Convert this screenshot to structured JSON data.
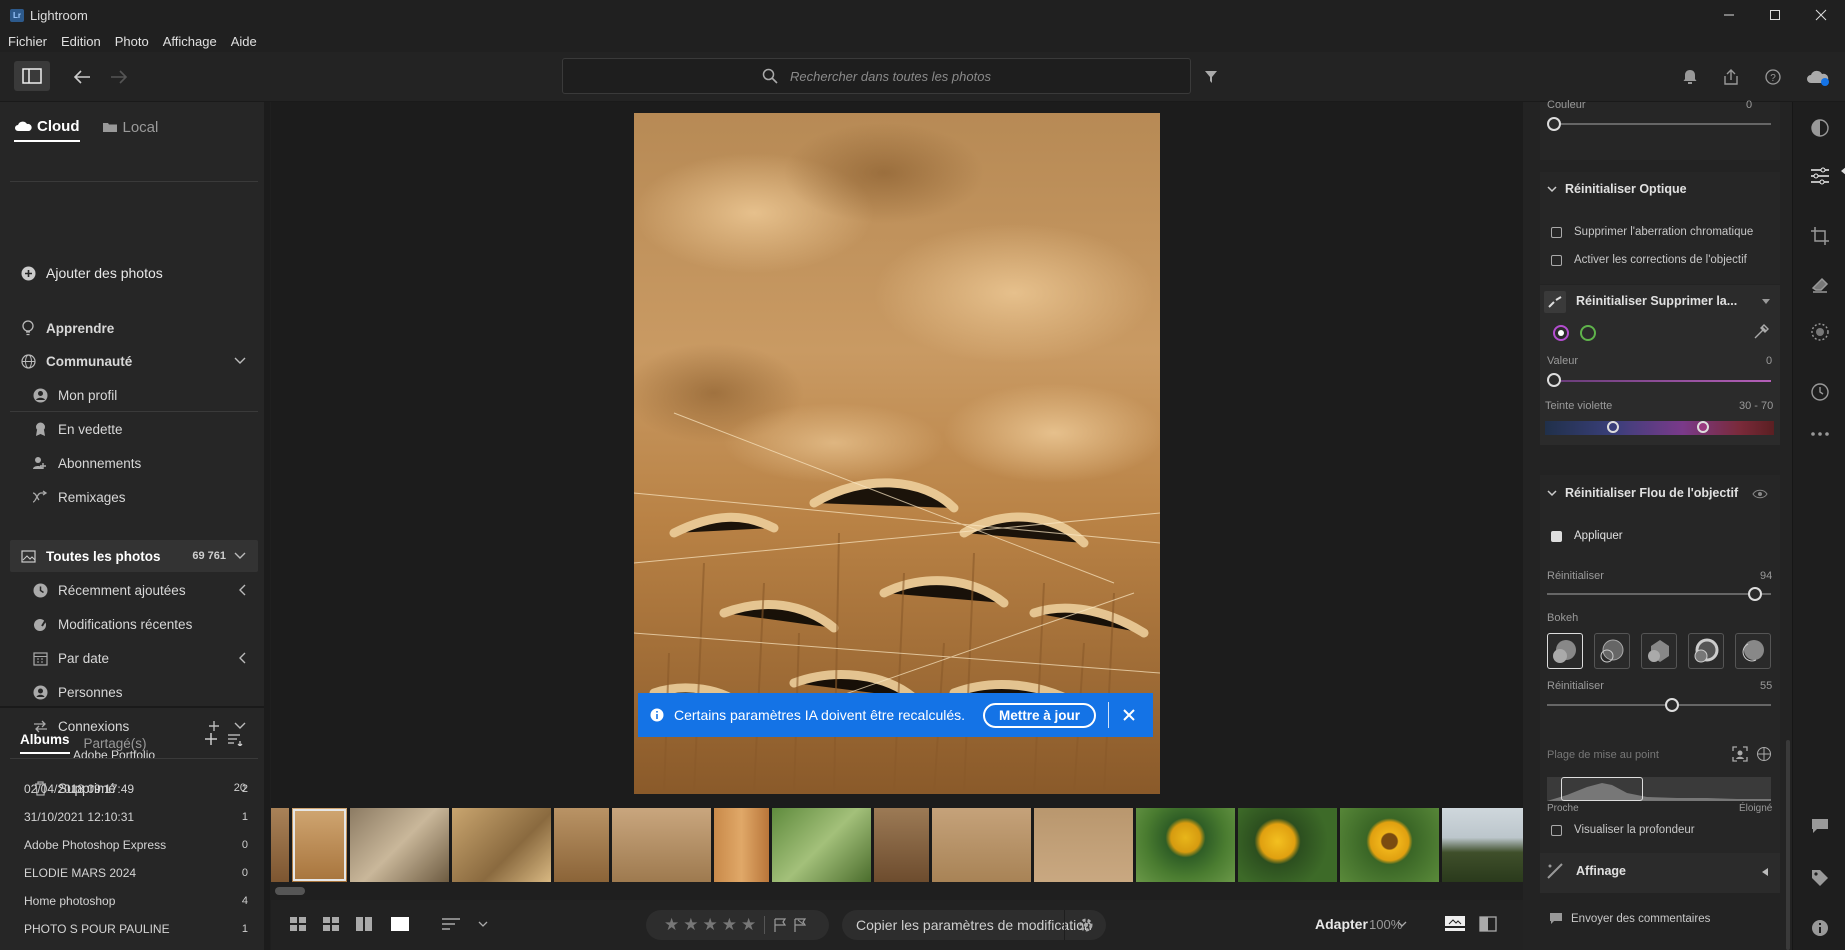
{
  "window": {
    "title": "Lightroom",
    "logo_text": "Lr"
  },
  "menu": [
    "Fichier",
    "Edition",
    "Photo",
    "Affichage",
    "Aide"
  ],
  "search": {
    "placeholder": "Rechercher dans toutes les photos"
  },
  "left": {
    "tabs": {
      "cloud": "Cloud",
      "local": "Local"
    },
    "add_photos": "Ajouter des photos",
    "learn": "Apprendre",
    "community": "Communauté",
    "community_items": [
      "Mon profil",
      "En vedette",
      "Abonnements",
      "Remixages"
    ],
    "all_photos": {
      "label": "Toutes les photos",
      "count": "69 761"
    },
    "library_items": [
      "Récemment ajoutées",
      "Modifications récentes",
      "Par date",
      "Personnes",
      "Connexions"
    ],
    "adobe_portfolio": "Adobe Portfolio",
    "deleted": {
      "label": "Supprimé",
      "count": "20"
    },
    "albums_tab": "Albums",
    "shared_tab": "Partagé(s)",
    "albums": [
      {
        "name": "02/04/2018 09:17:49",
        "count": "2"
      },
      {
        "name": "31/10/2021 12:10:31",
        "count": "1"
      },
      {
        "name": "Adobe Photoshop Express",
        "count": "0"
      },
      {
        "name": "ELODIE MARS 2024",
        "count": "0"
      },
      {
        "name": "Home photoshop",
        "count": "4"
      },
      {
        "name": "PHOTO S POUR PAULINE",
        "count": "1"
      }
    ]
  },
  "banner": {
    "text": "Certains paramètres IA doivent être recalculés.",
    "button": "Mettre à jour"
  },
  "bottom": {
    "copy_settings": "Copier les paramètres de modification",
    "fit": "Adapter",
    "zoom": "100%"
  },
  "right": {
    "couleur": {
      "label": "Couleur",
      "value": "0"
    },
    "optique": {
      "title": "Réinitialiser Optique",
      "opt1": "Supprimer l'aberration chromatique",
      "opt2": "Activer les corrections de l'objectif"
    },
    "fringe": {
      "title": "Réinitialiser Supprimer la...",
      "valeur_label": "Valeur",
      "valeur": "0",
      "teinte_label": "Teinte violette",
      "teinte_range": "30 - 70"
    },
    "flou": {
      "title": "Réinitialiser Flou de l'objectif",
      "apply": "Appliquer",
      "reset1_label": "Réinitialiser",
      "reset1": "94",
      "bokeh_label": "Bokeh",
      "reset2_label": "Réinitialiser",
      "reset2": "55",
      "focus_label": "Plage de mise au point",
      "near": "Proche",
      "far": "Éloigné",
      "visualize": "Visualiser la profondeur"
    },
    "affinage": "Affinage",
    "feedback": "Envoyer des commentaires"
  }
}
